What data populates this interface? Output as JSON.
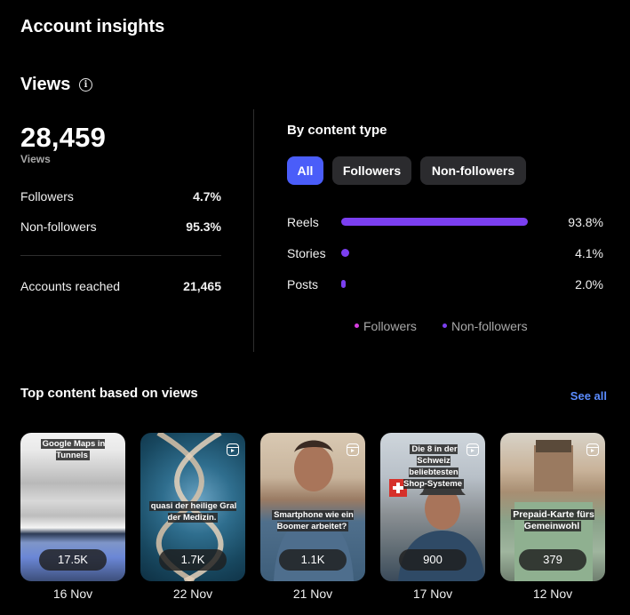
{
  "header": {
    "title": "Account insights"
  },
  "views": {
    "title": "Views",
    "total": "28,459",
    "total_label": "Views",
    "rows": [
      {
        "label": "Followers",
        "value": "4.7%"
      },
      {
        "label": "Non-followers",
        "value": "95.3%"
      }
    ],
    "reached": {
      "label": "Accounts reached",
      "value": "21,465"
    }
  },
  "content_type": {
    "title": "By content type",
    "filters": [
      {
        "label": "All",
        "active": true
      },
      {
        "label": "Followers",
        "active": false
      },
      {
        "label": "Non-followers",
        "active": false
      }
    ],
    "bars": [
      {
        "label": "Reels",
        "percent_text": "93.8%",
        "value": 93.8
      },
      {
        "label": "Stories",
        "percent_text": "4.1%",
        "value": 4.1
      },
      {
        "label": "Posts",
        "percent_text": "2.0%",
        "value": 2.0
      }
    ],
    "legend": [
      {
        "label": "Followers",
        "color": "#d63de0"
      },
      {
        "label": "Non-followers",
        "color": "#7b3ff0"
      }
    ]
  },
  "top_content": {
    "title": "Top content based on views",
    "see_all": "See all",
    "items": [
      {
        "overlay": "Google Maps in Tunnels",
        "count": "17.5K",
        "date": "16 Nov"
      },
      {
        "overlay": "quasi der heilige Gral der Medizin.",
        "count": "1.7K",
        "date": "22 Nov"
      },
      {
        "overlay": "Smartphone wie ein Boomer arbeitet?",
        "count": "1.1K",
        "date": "21 Nov"
      },
      {
        "overlay": "Die 8 in der Schweiz beliebtesten Shop-Systeme",
        "count": "900",
        "date": "17 Nov"
      },
      {
        "overlay": "Prepaid-Karte fürs Gemeinwohl",
        "count": "379",
        "date": "12 Nov"
      }
    ]
  },
  "colors": {
    "accent": "#4a5df9",
    "link": "#5b8cff",
    "bar": "#7b3ff0",
    "background": "#000000"
  }
}
